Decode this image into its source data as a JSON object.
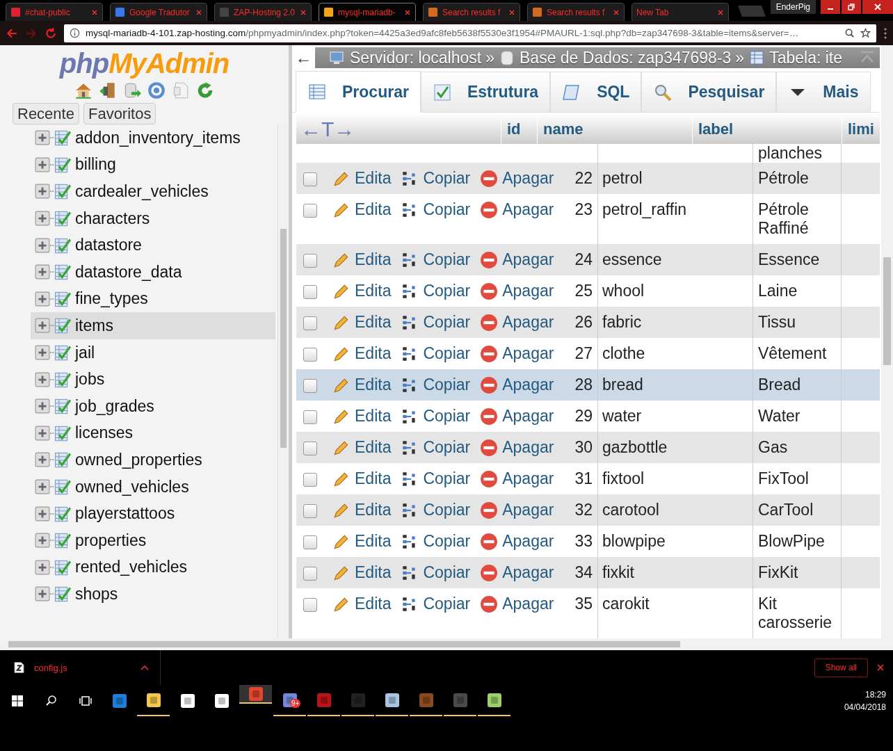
{
  "browser": {
    "tabs": [
      {
        "kind": "calendar",
        "title": "#chat-public",
        "selected": false
      },
      {
        "kind": "translate",
        "title": "Google Tradutor",
        "selected": false
      },
      {
        "kind": "zap",
        "title": "ZAP-Hosting 2.0",
        "selected": false
      },
      {
        "kind": "pma",
        "title": "mysql-mariadb-",
        "selected": true
      },
      {
        "kind": "flame",
        "title": "Search results f",
        "selected": false
      },
      {
        "kind": "flame",
        "title": "Search results f",
        "selected": false
      },
      {
        "kind": "blank",
        "title": "New Tab",
        "selected": false
      }
    ],
    "profile": "EnderPig",
    "url_host": "mysql-mariadb-4-101.zap-hosting.com",
    "url_path": "/phpmyadmin/index.php?token=4425a3ed9afc8feb5638f5530e3f1954#PMAURL-1:sql.php?db=zap347698-3&table=items&server=…"
  },
  "sidebar": {
    "logo_left": "php",
    "logo_right": "MyAdmin",
    "buttons": [
      "Recente",
      "Favoritos"
    ],
    "tables": [
      {
        "name": "addon_inventory_items",
        "selected": false
      },
      {
        "name": "billing",
        "selected": false
      },
      {
        "name": "cardealer_vehicles",
        "selected": false
      },
      {
        "name": "characters",
        "selected": false
      },
      {
        "name": "datastore",
        "selected": false
      },
      {
        "name": "datastore_data",
        "selected": false
      },
      {
        "name": "fine_types",
        "selected": false
      },
      {
        "name": "items",
        "selected": true
      },
      {
        "name": "jail",
        "selected": false
      },
      {
        "name": "jobs",
        "selected": false
      },
      {
        "name": "job_grades",
        "selected": false
      },
      {
        "name": "licenses",
        "selected": false
      },
      {
        "name": "owned_properties",
        "selected": false
      },
      {
        "name": "owned_vehicles",
        "selected": false
      },
      {
        "name": "playerstattoos",
        "selected": false
      },
      {
        "name": "properties",
        "selected": false
      },
      {
        "name": "rented_vehicles",
        "selected": false
      },
      {
        "name": "shops",
        "selected": false
      }
    ]
  },
  "main": {
    "back": "←",
    "breadcrumb": [
      {
        "kind": "server",
        "text": "Servidor: localhost",
        "after": "»"
      },
      {
        "kind": "database",
        "text": "Base de Dados: zap347698-3",
        "after": "»"
      },
      {
        "kind": "table",
        "text": "Tabela: ite"
      }
    ],
    "tabs": [
      {
        "kind": "browse",
        "label": "Procurar",
        "selected": true
      },
      {
        "kind": "structure",
        "label": "Estrutura",
        "selected": false
      },
      {
        "kind": "sql",
        "label": "SQL",
        "selected": false
      },
      {
        "kind": "search",
        "label": "Pesquisar",
        "selected": false
      },
      {
        "kind": "more",
        "label": "Mais",
        "selected": false
      }
    ],
    "table": {
      "sort_handle": "←T→",
      "columns": [
        "id",
        "name",
        "label",
        "limi"
      ],
      "rows": [
        {
          "kind": "partial",
          "label": "planches"
        },
        {
          "kind": "record",
          "id": "22",
          "name": "petrol",
          "label": "Pétrole",
          "actions": [
            "Edita",
            "Copiar",
            "Apagar"
          ],
          "checked": false,
          "highlighted": false
        },
        {
          "kind": "record",
          "id": "23",
          "name": "petrol_raffin",
          "label": "Pétrole Raffiné",
          "actions": [
            "Edita",
            "Copiar",
            "Apagar"
          ],
          "checked": false,
          "highlighted": false
        },
        {
          "kind": "record",
          "id": "24",
          "name": "essence",
          "label": "Essence",
          "actions": [
            "Edita",
            "Copiar",
            "Apagar"
          ],
          "checked": false,
          "highlighted": false
        },
        {
          "kind": "record",
          "id": "25",
          "name": "whool",
          "label": "Laine",
          "actions": [
            "Edita",
            "Copiar",
            "Apagar"
          ],
          "checked": false,
          "highlighted": false
        },
        {
          "kind": "record",
          "id": "26",
          "name": "fabric",
          "label": "Tissu",
          "actions": [
            "Edita",
            "Copiar",
            "Apagar"
          ],
          "checked": false,
          "highlighted": false
        },
        {
          "kind": "record",
          "id": "27",
          "name": "clothe",
          "label": "Vêtement",
          "actions": [
            "Edita",
            "Copiar",
            "Apagar"
          ],
          "checked": false,
          "highlighted": false
        },
        {
          "kind": "record",
          "id": "28",
          "name": "bread",
          "label": "Bread",
          "actions": [
            "Edita",
            "Copiar",
            "Apagar"
          ],
          "checked": false,
          "highlighted": true
        },
        {
          "kind": "record",
          "id": "29",
          "name": "water",
          "label": "Water",
          "actions": [
            "Edita",
            "Copiar",
            "Apagar"
          ],
          "checked": false,
          "highlighted": false
        },
        {
          "kind": "record",
          "id": "30",
          "name": "gazbottle",
          "label": "Gas",
          "actions": [
            "Edita",
            "Copiar",
            "Apagar"
          ],
          "checked": false,
          "highlighted": false
        },
        {
          "kind": "record",
          "id": "31",
          "name": "fixtool",
          "label": "FixTool",
          "actions": [
            "Edita",
            "Copiar",
            "Apagar"
          ],
          "checked": false,
          "highlighted": false
        },
        {
          "kind": "record",
          "id": "32",
          "name": "carotool",
          "label": "CarTool",
          "actions": [
            "Edita",
            "Copiar",
            "Apagar"
          ],
          "checked": false,
          "highlighted": false
        },
        {
          "kind": "record",
          "id": "33",
          "name": "blowpipe",
          "label": "BlowPipe",
          "actions": [
            "Edita",
            "Copiar",
            "Apagar"
          ],
          "checked": false,
          "highlighted": false
        },
        {
          "kind": "record",
          "id": "34",
          "name": "fixkit",
          "label": "FixKit",
          "actions": [
            "Edita",
            "Copiar",
            "Apagar"
          ],
          "checked": false,
          "highlighted": false
        },
        {
          "kind": "record",
          "id": "35",
          "name": "carokit",
          "label": "Kit carosserie",
          "actions": [
            "Edita",
            "Copiar",
            "Apagar"
          ],
          "checked": false,
          "highlighted": false
        }
      ]
    }
  },
  "downloads": {
    "file": "config.js",
    "show_all": "Show all"
  },
  "taskbar": {
    "apps": [
      {
        "kind": "edge",
        "running": false,
        "active": false
      },
      {
        "kind": "folder",
        "running": true,
        "active": false
      },
      {
        "kind": "store",
        "running": false,
        "active": false
      },
      {
        "kind": "mail",
        "running": false,
        "active": false
      },
      {
        "kind": "chrome",
        "running": true,
        "active": true
      },
      {
        "kind": "chat",
        "running": true,
        "active": false,
        "badge": "9+"
      },
      {
        "kind": "ftp",
        "running": true,
        "active": false
      },
      {
        "kind": "terminal",
        "running": true,
        "active": false
      },
      {
        "kind": "monitor",
        "running": true,
        "active": false
      },
      {
        "kind": "game",
        "running": true,
        "active": false
      },
      {
        "kind": "editor",
        "running": true,
        "active": false
      },
      {
        "kind": "notepad",
        "running": true,
        "active": false
      }
    ],
    "time": "18:29",
    "date": "04/04/2018"
  }
}
